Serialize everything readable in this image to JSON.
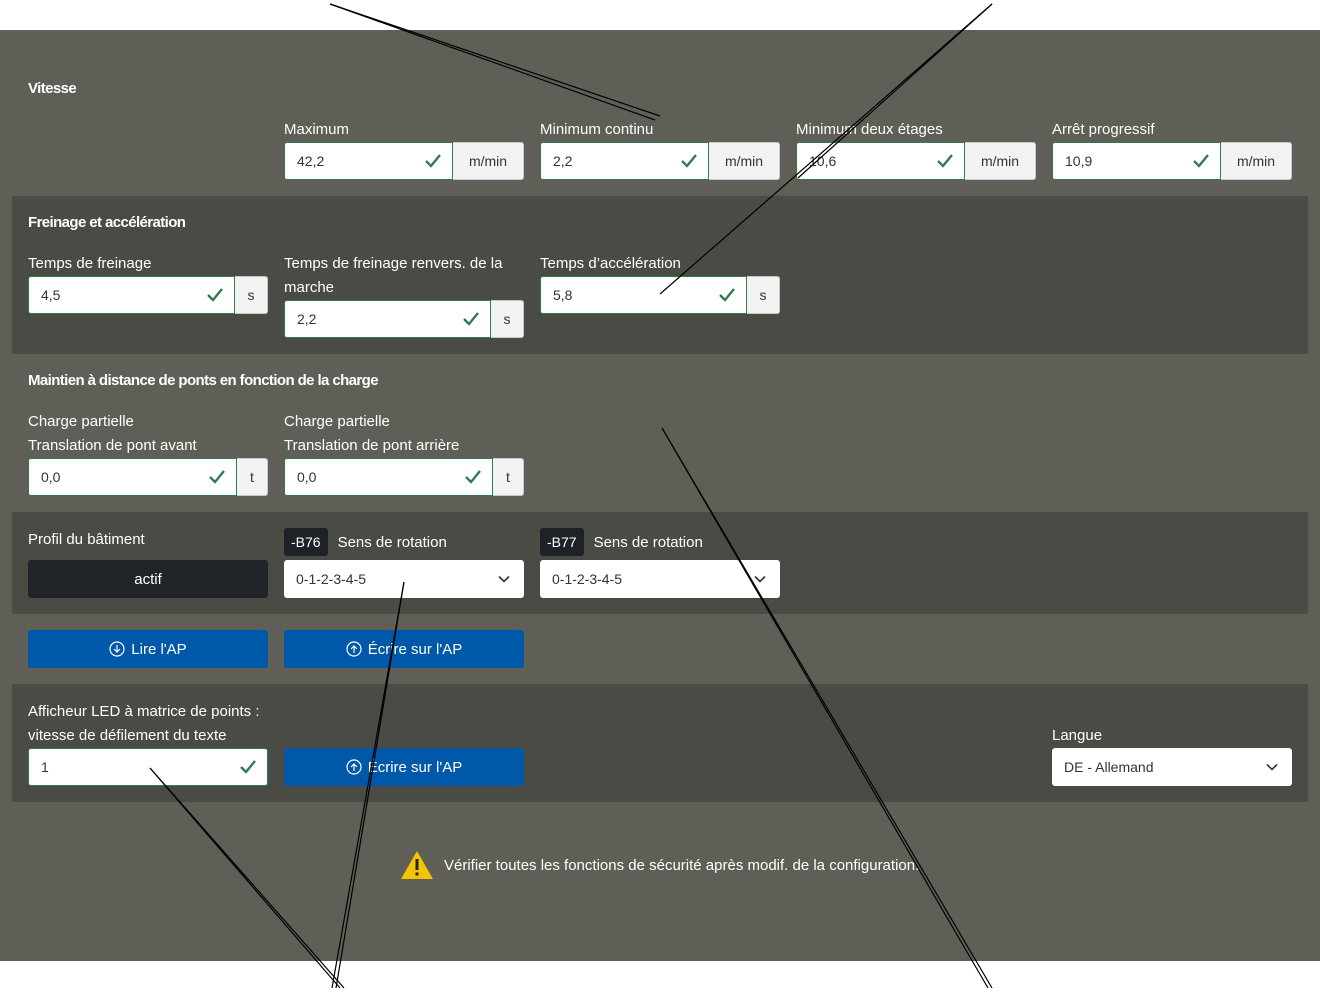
{
  "speed": {
    "title": "Vitesse",
    "fields": [
      {
        "label": "Maximum",
        "value": "42,2",
        "unit": "m/min"
      },
      {
        "label": "Minimum continu",
        "value": "2,2",
        "unit": "m/min"
      },
      {
        "label": "Minimum deux étages",
        "value": "10,6",
        "unit": "m/min"
      },
      {
        "label": "Arrêt progressif",
        "value": "10,9",
        "unit": "m/min"
      }
    ]
  },
  "braking": {
    "title": "Freinage et accélération",
    "fields": [
      {
        "label": "Temps de freinage",
        "value": "4,5",
        "unit": "s"
      },
      {
        "label": "Temps de freinage renvers. de la marche",
        "value": "2,2",
        "unit": "s"
      },
      {
        "label": "Temps d’accélération",
        "value": "5,8",
        "unit": "s"
      }
    ]
  },
  "distance": {
    "title": "Maintien à distance de ponts en fonction de la charge",
    "fields": [
      {
        "label1": "Charge partielle",
        "label2": "Translation de pont avant",
        "value": "0,0",
        "unit": "t"
      },
      {
        "label1": "Charge partielle",
        "label2": "Translation de pont arrière",
        "value": "0,0",
        "unit": "t"
      }
    ]
  },
  "profile": {
    "label": "Profil du bâtiment",
    "button": "actif",
    "rotations": [
      {
        "badge": "-B76",
        "label": "Sens de rotation",
        "value": "0-1-2-3-4-5"
      },
      {
        "badge": "-B77",
        "label": "Sens de rotation",
        "value": "0-1-2-3-4-5"
      }
    ]
  },
  "actions": {
    "read": "Lire l'AP",
    "write": "Écrire sur l'AP"
  },
  "led": {
    "label1": "Afficheur LED à matrice de points :",
    "label2": "vitesse de défilement du texte",
    "value": "1",
    "write": "Écrire sur l'AP",
    "lang_label": "Langue",
    "lang_value": "DE - Allemand"
  },
  "warning": "Vérifier toutes les fonctions de sécurité après modif. de la configuration.",
  "colors": {
    "panel": "#5f5f57",
    "section": "#4b4b45",
    "primary": "#0058a8",
    "valid": "#2f7d4e",
    "warning": "#f5c400"
  }
}
